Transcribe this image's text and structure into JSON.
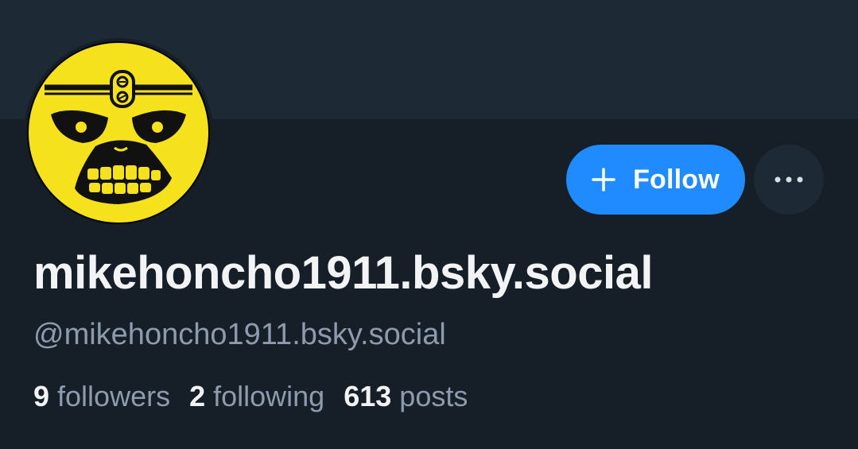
{
  "profile": {
    "display_name": "mikehoncho1911.bsky.social",
    "handle": "@mikehoncho1911.bsky.social",
    "avatar_icon": "skull-face-avatar-icon",
    "avatar_color": "#f5e11c"
  },
  "actions": {
    "follow_label": "Follow",
    "follow_icon": "plus-icon",
    "more_icon": "ellipsis-icon",
    "accent_color": "#208bfe"
  },
  "stats": {
    "followers_count": "9",
    "followers_label": "followers",
    "following_count": "2",
    "following_label": "following",
    "posts_count": "613",
    "posts_label": "posts"
  }
}
